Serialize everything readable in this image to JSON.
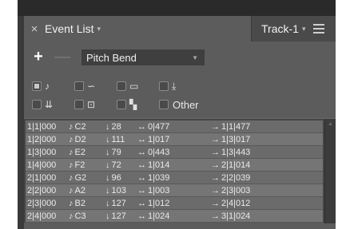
{
  "tab": {
    "close_icon": "×",
    "title": "Event List",
    "caret": "▾"
  },
  "track": {
    "name": "Track-1",
    "caret": "▾"
  },
  "toolbar": {
    "add_label": "+",
    "remove_label": "—",
    "event_type": "Pitch Bend",
    "dropdown_arrow": "▼"
  },
  "filters": [
    {
      "id": "note",
      "icon": "note-icon",
      "glyph": "♪",
      "checked": true
    },
    {
      "id": "pitchbend",
      "icon": "wave-icon",
      "glyph": "∽",
      "checked": false
    },
    {
      "id": "controller",
      "icon": "slider-icon",
      "glyph": "▭",
      "checked": false
    },
    {
      "id": "aftertouch",
      "icon": "download-arrow-icon",
      "glyph": "⤓",
      "checked": false
    },
    {
      "id": "chan-pressure",
      "icon": "double-arrow-icon",
      "glyph": "⇊",
      "checked": false
    },
    {
      "id": "program",
      "icon": "box-icon",
      "glyph": "⊡",
      "checked": false
    },
    {
      "id": "sysex",
      "icon": "blocks-icon",
      "glyph": "▚",
      "checked": false
    },
    {
      "id": "other",
      "icon": null,
      "label": "Other",
      "checked": false
    }
  ],
  "event_icons": {
    "note": "♪",
    "velocity": "↓",
    "length": "↔",
    "end": "→"
  },
  "events": [
    {
      "pos": "1|1|000",
      "note": "C2",
      "vel": "28",
      "len": "0|477",
      "end": "1|1|477"
    },
    {
      "pos": "1|2|000",
      "note": "D2",
      "vel": "111",
      "len": "1|017",
      "end": "1|3|017"
    },
    {
      "pos": "1|3|000",
      "note": "E2",
      "vel": "79",
      "len": "0|443",
      "end": "1|3|443"
    },
    {
      "pos": "1|4|000",
      "note": "F2",
      "vel": "72",
      "len": "1|014",
      "end": "2|1|014"
    },
    {
      "pos": "2|1|000",
      "note": "G2",
      "vel": "96",
      "len": "1|039",
      "end": "2|2|039"
    },
    {
      "pos": "2|2|000",
      "note": "A2",
      "vel": "103",
      "len": "1|003",
      "end": "2|3|003"
    },
    {
      "pos": "2|3|000",
      "note": "B2",
      "vel": "127",
      "len": "1|012",
      "end": "2|4|012"
    },
    {
      "pos": "2|4|000",
      "note": "C3",
      "vel": "127",
      "len": "1|024",
      "end": "3|1|024"
    }
  ]
}
